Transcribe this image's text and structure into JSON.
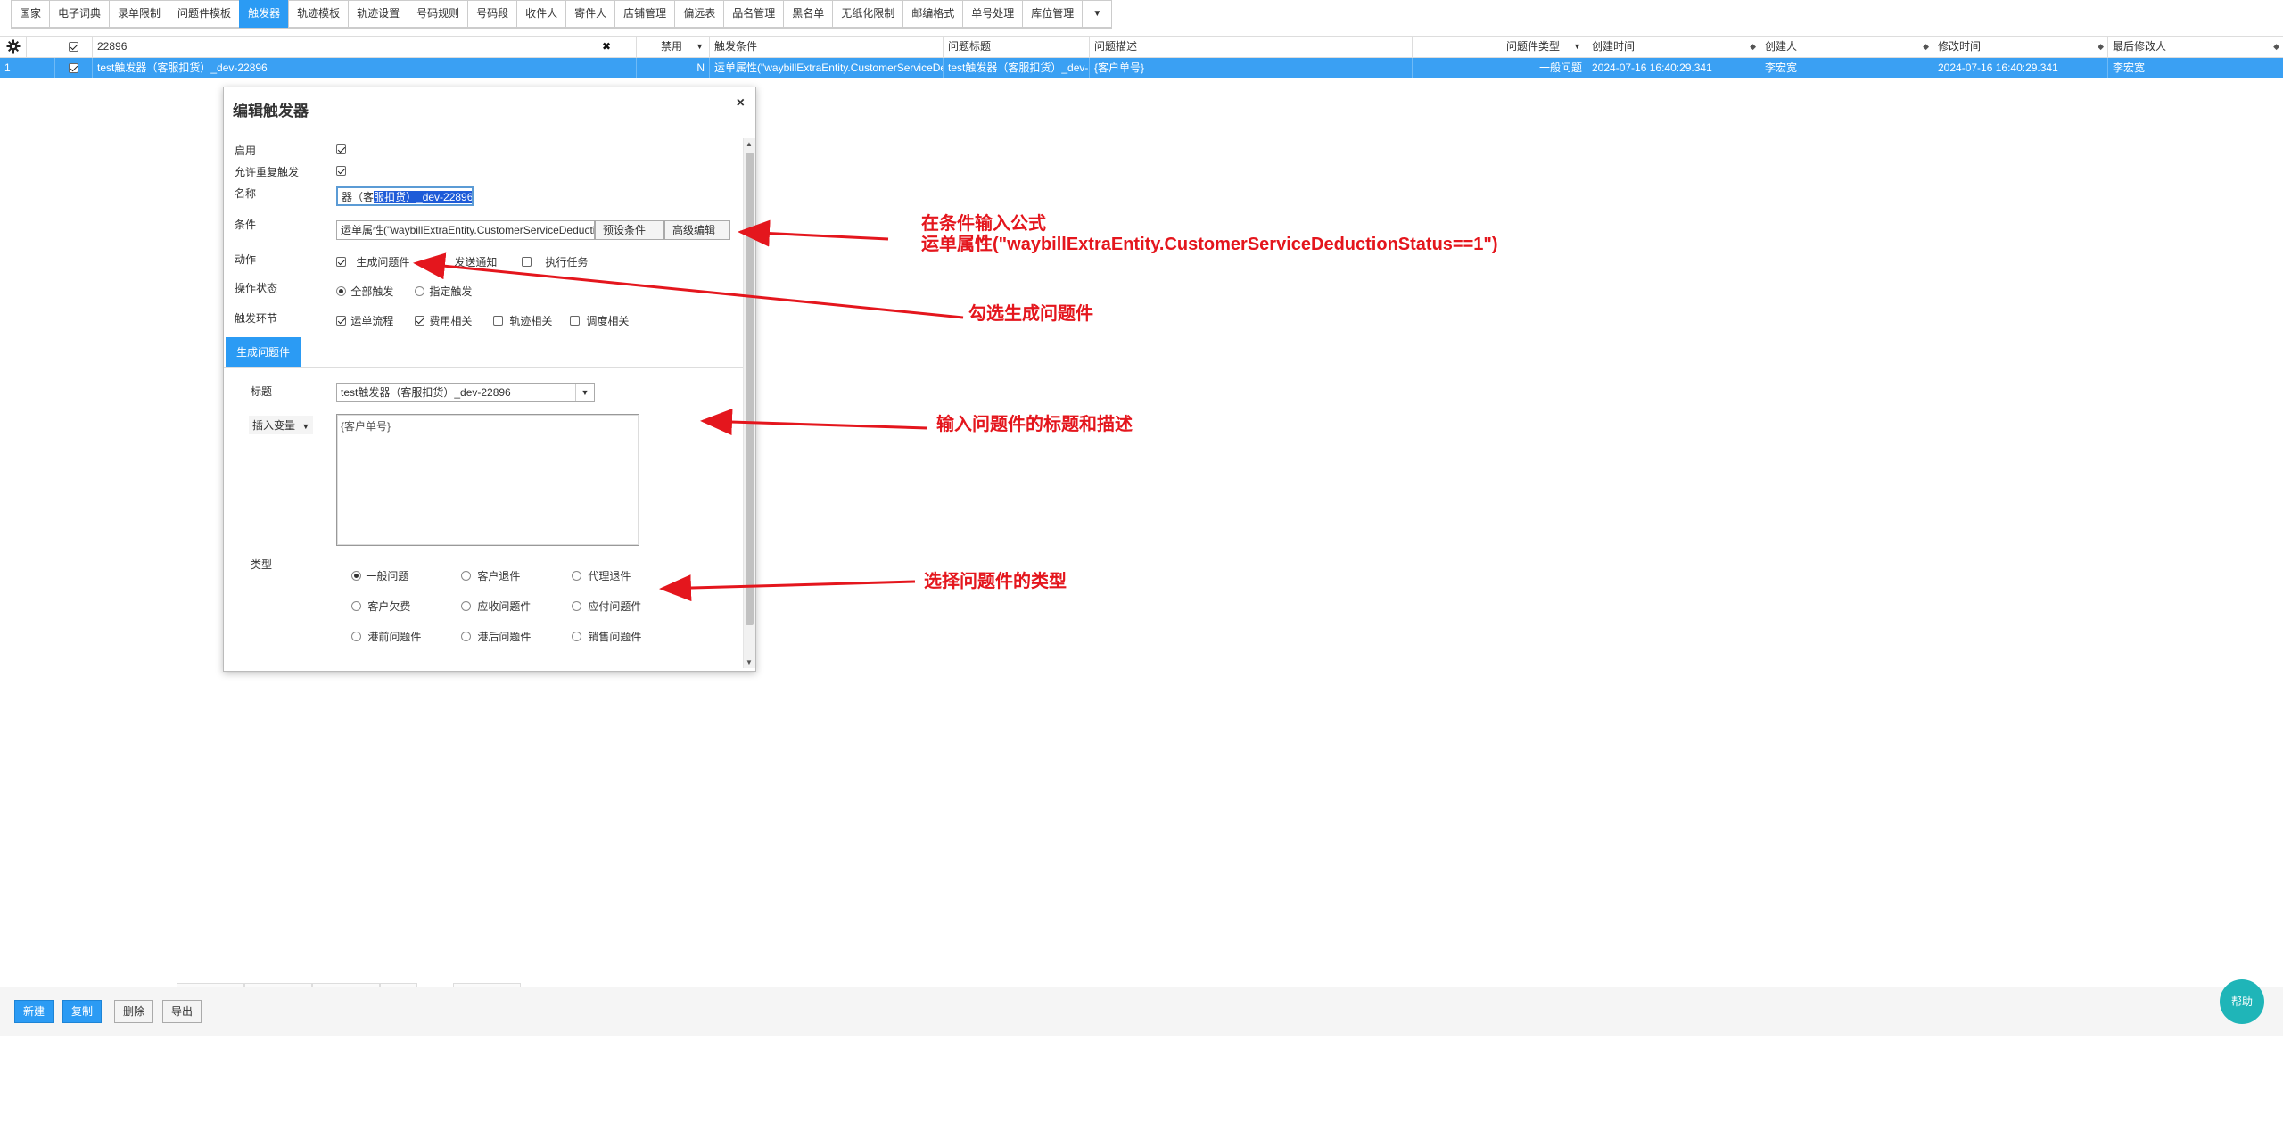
{
  "tabs": [
    "国家",
    "电子词典",
    "录单限制",
    "问题件模板",
    "触发器",
    "轨迹模板",
    "轨迹设置",
    "号码规则",
    "号码段",
    "收件人",
    "寄件人",
    "店铺管理",
    "偏远表",
    "品名管理",
    "黑名单",
    "无纸化限制",
    "邮编格式",
    "单号处理",
    "库位管理"
  ],
  "active_tab": "触发器",
  "tabs_more_icon": "chevron-down-icon",
  "grid": {
    "filter_value": "22896",
    "filter_clear": "✖",
    "columns": {
      "disabled": "禁用",
      "condition": "触发条件",
      "issue_title": "问题标题",
      "issue_desc": "问题描述",
      "issue_type": "问题件类型",
      "created_time": "创建时间",
      "creator": "创建人",
      "modified_time": "修改时间",
      "modifier": "最后修改人"
    },
    "row": {
      "index": "1",
      "name": "test触发器（客服扣货）_dev-22896",
      "disabled": "N",
      "condition": "运单属性(\"waybillExtraEntity.CustomerServiceDeductionStatus==1\")",
      "issue_title": "test触发器（客服扣货）_dev-22896",
      "issue_desc": "{客户单号}",
      "issue_type": "一般问题",
      "created_time": "2024-07-16 16:40:29.341",
      "creator": "李宏宽",
      "modified_time": "2024-07-16 16:40:29.341",
      "modifier": "李宏宽"
    }
  },
  "modal": {
    "title": "编辑触发器",
    "close": "×",
    "labels": {
      "enabled": "启用",
      "allow_repeat": "允许重复触发",
      "name": "名称",
      "condition": "条件",
      "action": "动作",
      "op_status": "操作状态",
      "trigger_stage": "触发环节",
      "title": "标题",
      "type": "类型"
    },
    "name_value_prefix": "器（客",
    "name_value_selected": "服扣货）_dev-22896",
    "condition_value": "运单属性(\"waybillExtraEntity.CustomerServiceDeductionStatus==1\")",
    "preset_btn": "预设条件",
    "advanced_btn": "高级编辑",
    "actions": [
      "生成问题件",
      "发送通知",
      "执行任务"
    ],
    "op_status": [
      "全部触发",
      "指定触发"
    ],
    "stages": [
      "运单流程",
      "费用相关",
      "轨迹相关",
      "调度相关"
    ],
    "gen_tab": "生成问题件",
    "title_value": "test触发器（客服扣货）_dev-22896",
    "insert_var": "插入变量",
    "desc_value": "{客户单号}",
    "types": [
      "一般问题",
      "客户退件",
      "代理退件",
      "客户欠费",
      "应收问题件",
      "应付问题件",
      "港前问题件",
      "港后问题件",
      "销售问题件"
    ]
  },
  "annotations": {
    "a1_line1": "在条件输入公式",
    "a1_line2": "运单属性(\"waybillExtraEntity.CustomerServiceDeductionStatus==1\")",
    "a2": "勾选生成问题件",
    "a3": "输入问题件的标题和描述",
    "a4": "选择问题件的类型"
  },
  "bottom": {
    "new": "新建",
    "copy": "复制",
    "delete": "删除",
    "export": "导出",
    "help": "帮助"
  },
  "colors": {
    "accent": "#2b9bf4",
    "annotation": "#e4161d",
    "help": "#1fb5b8"
  }
}
